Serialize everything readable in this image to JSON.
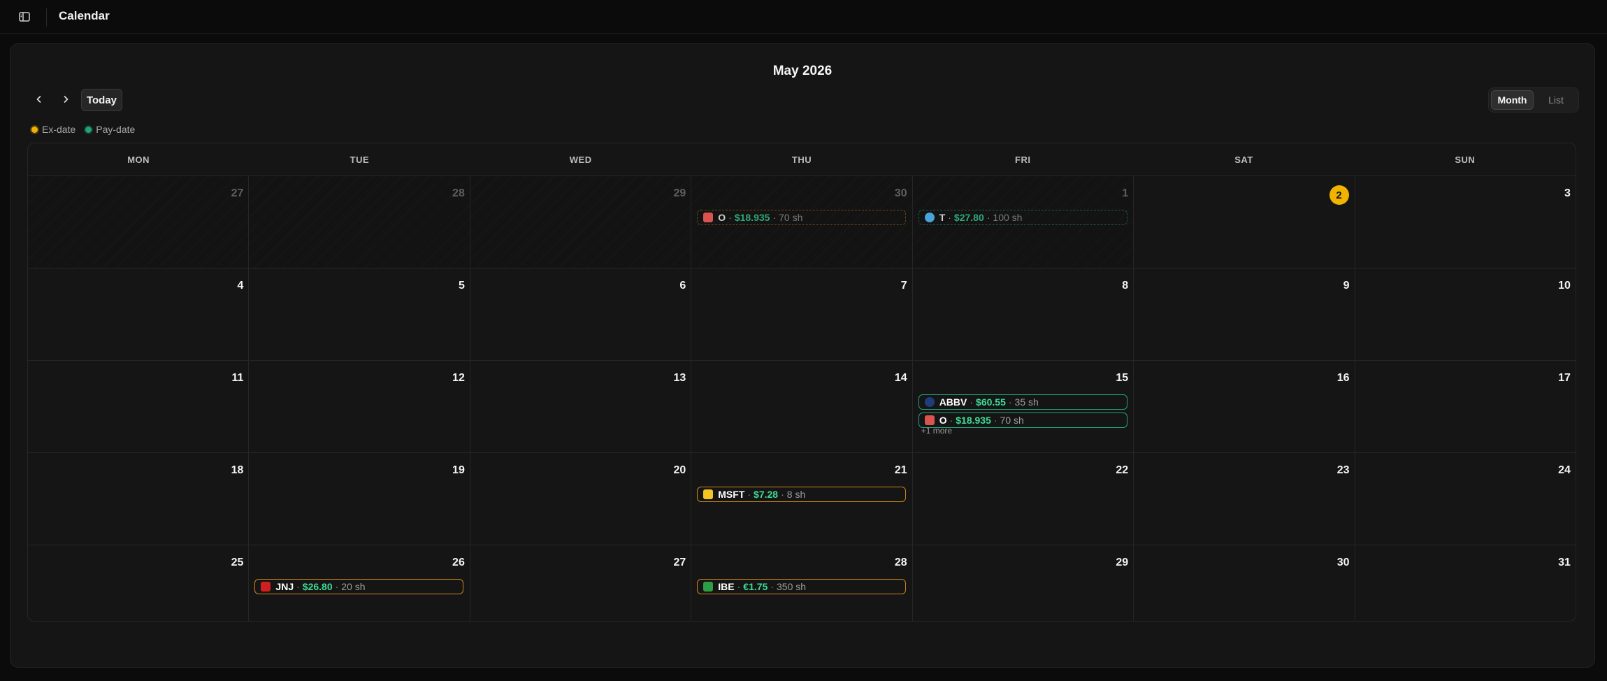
{
  "app": {
    "title": "Calendar"
  },
  "calendar": {
    "month_label": "May 2026",
    "today_label": "Today",
    "views": {
      "month": "Month",
      "list": "List"
    },
    "legend": [
      {
        "label": "Ex-date",
        "color": "#f0b400"
      },
      {
        "label": "Pay-date",
        "color": "#23a37a"
      }
    ],
    "weekdays": [
      "MON",
      "TUE",
      "WED",
      "THU",
      "FRI",
      "SAT",
      "SUN"
    ],
    "weeks": [
      [
        "27",
        "28",
        "29",
        "30",
        "1",
        "2",
        "3"
      ],
      [
        "4",
        "5",
        "6",
        "7",
        "8",
        "9",
        "10"
      ],
      [
        "11",
        "12",
        "13",
        "14",
        "15",
        "16",
        "17"
      ],
      [
        "18",
        "19",
        "20",
        "21",
        "22",
        "23",
        "24"
      ],
      [
        "25",
        "26",
        "27",
        "28",
        "29",
        "30",
        "31"
      ]
    ],
    "today": "2",
    "events": {
      "apr30_o": {
        "ticker": "O",
        "amount": "$18.935",
        "shares": "70 sh",
        "kind": "ex-date",
        "logo_color": "#d9534f"
      },
      "may1_t": {
        "ticker": "T",
        "amount": "$27.80",
        "shares": "100 sh",
        "kind": "pay-date",
        "logo_color": "#4aa3d8"
      },
      "may15_abbv": {
        "ticker": "ABBV",
        "amount": "$60.55",
        "shares": "35 sh",
        "kind": "pay-date",
        "logo_color": "#1f3d7a"
      },
      "may15_o": {
        "ticker": "O",
        "amount": "$18.935",
        "shares": "70 sh",
        "kind": "pay-date",
        "logo_color": "#d9534f"
      },
      "may21_msft": {
        "ticker": "MSFT",
        "amount": "$7.28",
        "shares": "8 sh",
        "kind": "ex-date",
        "logo_color": "#f3c623"
      },
      "may26_jnj": {
        "ticker": "JNJ",
        "amount": "$26.80",
        "shares": "20 sh",
        "kind": "ex-date",
        "logo_color": "#d11f1f"
      },
      "may28_ibe": {
        "ticker": "IBE",
        "amount": "€1.75",
        "shares": "350 sh",
        "kind": "ex-date",
        "logo_color": "#2e9e44"
      }
    },
    "more_label": "+1 more"
  }
}
